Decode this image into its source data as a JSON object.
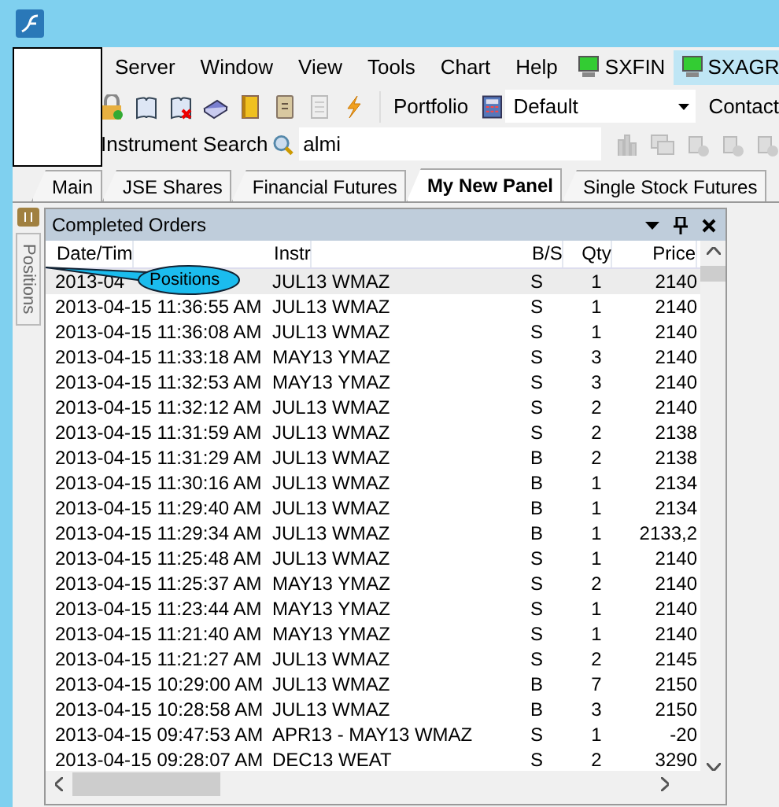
{
  "menu": [
    "Server",
    "Window",
    "View",
    "Tools",
    "Chart",
    "Help"
  ],
  "servers": [
    {
      "label": "SXFIN",
      "selected": false
    },
    {
      "label": "SXAGR",
      "selected": true
    }
  ],
  "toolbar": {
    "portfolio_label": "Portfolio",
    "portfolio": "Default",
    "contact_label": "Contact"
  },
  "search": {
    "label": "Instrument Search",
    "value": "almi"
  },
  "tabs": [
    {
      "label": "Main",
      "selected": false
    },
    {
      "label": "JSE Shares",
      "selected": false
    },
    {
      "label": "Financial Futures",
      "selected": false
    },
    {
      "label": "My New Panel",
      "selected": true
    },
    {
      "label": "Single Stock Futures",
      "selected": false
    }
  ],
  "side_tab": {
    "label": "Positions"
  },
  "panel": {
    "title": "Completed Orders",
    "columns": [
      "Date/Tim",
      "Instr",
      "B/S",
      "Qty",
      "Price"
    ],
    "rows": [
      {
        "date": "2013-04",
        "instr": "JUL13 WMAZ",
        "side": "S",
        "qty": "1",
        "price": "2140",
        "selected": true
      },
      {
        "date": "2013-04-15 11:36:55 AM",
        "instr": "JUL13 WMAZ",
        "side": "S",
        "qty": "1",
        "price": "2140",
        "selected": false
      },
      {
        "date": "2013-04-15 11:36:08 AM",
        "instr": "JUL13 WMAZ",
        "side": "S",
        "qty": "1",
        "price": "2140",
        "selected": false
      },
      {
        "date": "2013-04-15 11:33:18 AM",
        "instr": "MAY13 YMAZ",
        "side": "S",
        "qty": "3",
        "price": "2140",
        "selected": false
      },
      {
        "date": "2013-04-15 11:32:53 AM",
        "instr": "MAY13 YMAZ",
        "side": "S",
        "qty": "3",
        "price": "2140",
        "selected": false
      },
      {
        "date": "2013-04-15 11:32:12 AM",
        "instr": "JUL13 WMAZ",
        "side": "S",
        "qty": "2",
        "price": "2140",
        "selected": false
      },
      {
        "date": "2013-04-15 11:31:59 AM",
        "instr": "JUL13 WMAZ",
        "side": "S",
        "qty": "2",
        "price": "2138",
        "selected": false
      },
      {
        "date": "2013-04-15 11:31:29 AM",
        "instr": "JUL13 WMAZ",
        "side": "B",
        "qty": "2",
        "price": "2138",
        "selected": false
      },
      {
        "date": "2013-04-15 11:30:16 AM",
        "instr": "JUL13 WMAZ",
        "side": "B",
        "qty": "1",
        "price": "2134",
        "selected": false
      },
      {
        "date": "2013-04-15 11:29:40 AM",
        "instr": "JUL13 WMAZ",
        "side": "B",
        "qty": "1",
        "price": "2134",
        "selected": false
      },
      {
        "date": "2013-04-15 11:29:34 AM",
        "instr": "JUL13 WMAZ",
        "side": "B",
        "qty": "1",
        "price": "2133,2",
        "selected": false
      },
      {
        "date": "2013-04-15 11:25:48 AM",
        "instr": "JUL13 WMAZ",
        "side": "S",
        "qty": "1",
        "price": "2140",
        "selected": false
      },
      {
        "date": "2013-04-15 11:25:37 AM",
        "instr": "MAY13 YMAZ",
        "side": "S",
        "qty": "2",
        "price": "2140",
        "selected": false
      },
      {
        "date": "2013-04-15 11:23:44 AM",
        "instr": "MAY13 YMAZ",
        "side": "S",
        "qty": "1",
        "price": "2140",
        "selected": false
      },
      {
        "date": "2013-04-15 11:21:40 AM",
        "instr": "MAY13 YMAZ",
        "side": "S",
        "qty": "1",
        "price": "2140",
        "selected": false
      },
      {
        "date": "2013-04-15 11:21:27 AM",
        "instr": "JUL13 WMAZ",
        "side": "S",
        "qty": "2",
        "price": "2145",
        "selected": false
      },
      {
        "date": "2013-04-15 10:29:00 AM",
        "instr": "JUL13 WMAZ",
        "side": "B",
        "qty": "7",
        "price": "2150",
        "selected": false
      },
      {
        "date": "2013-04-15 10:28:58 AM",
        "instr": "JUL13 WMAZ",
        "side": "B",
        "qty": "3",
        "price": "2150",
        "selected": false
      },
      {
        "date": "2013-04-15 09:47:53 AM",
        "instr": "APR13 - MAY13 WMAZ",
        "side": "S",
        "qty": "1",
        "price": "-20",
        "selected": false
      },
      {
        "date": "2013-04-15 09:28:07 AM",
        "instr": "DEC13 WEAT",
        "side": "S",
        "qty": "2",
        "price": "3290",
        "selected": false
      }
    ]
  },
  "callout": {
    "text": "Positions"
  }
}
